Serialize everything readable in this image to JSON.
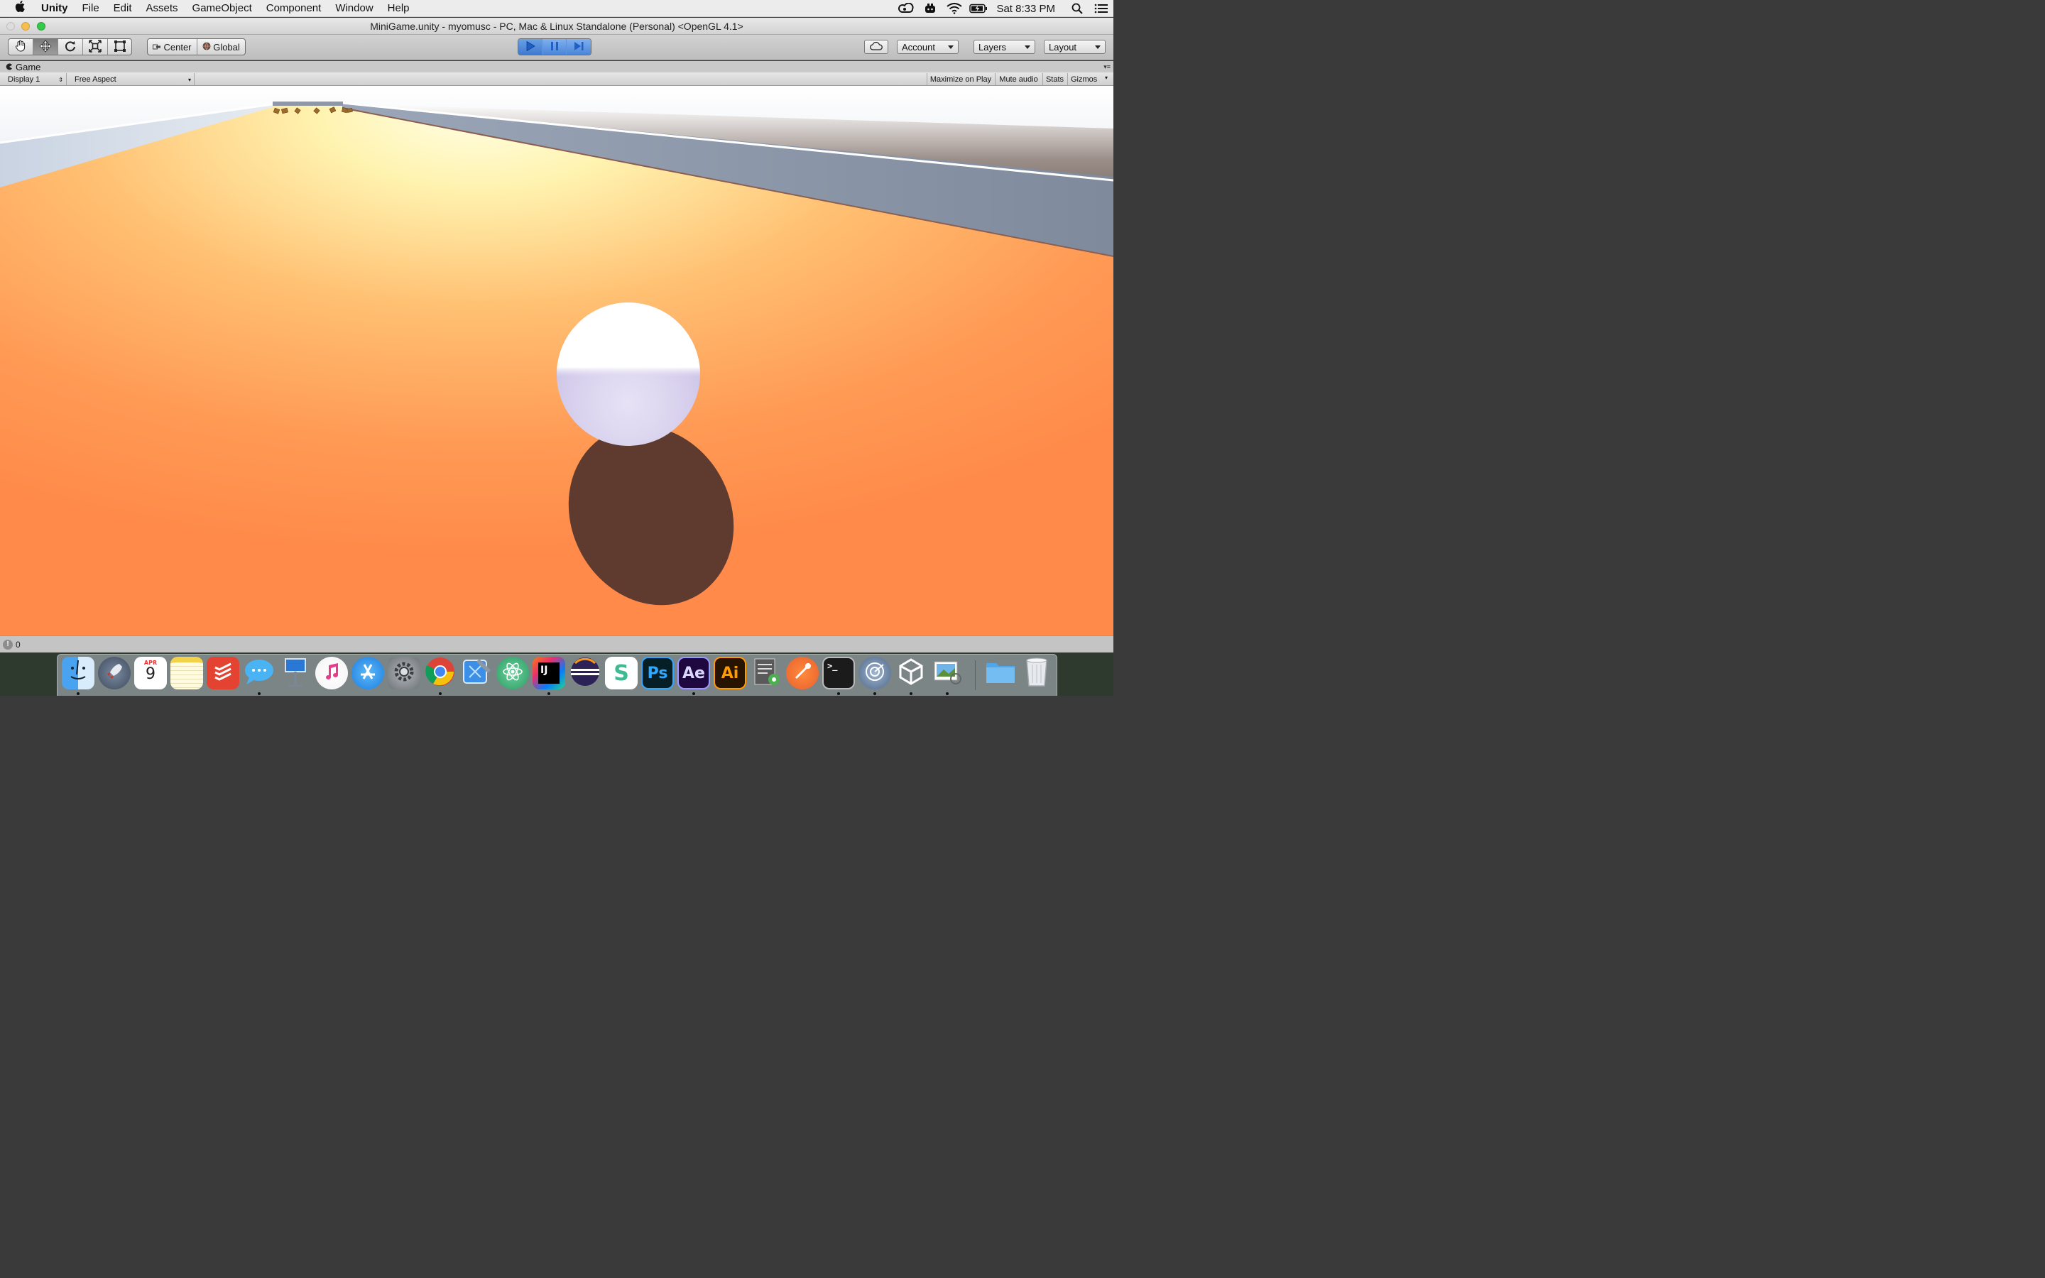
{
  "menubar": {
    "app_name": "Unity",
    "items": [
      "File",
      "Edit",
      "Assets",
      "GameObject",
      "Component",
      "Window",
      "Help"
    ],
    "clock": "Sat 8:33 PM",
    "status_icons": [
      "creative-cloud-icon",
      "game-controller-icon",
      "wifi-icon",
      "battery-icon",
      "spotlight-search-icon",
      "notification-center-icon"
    ]
  },
  "window": {
    "title": "MiniGame.unity - myomusc - PC, Mac & Linux Standalone (Personal) <OpenGL 4.1>"
  },
  "toolbar": {
    "pivot_label": "Center",
    "space_label": "Global",
    "account_label": "Account",
    "layers_label": "Layers",
    "layout_label": "Layout",
    "play_state": "playing",
    "colors": {
      "play_active": "#3f7ad0"
    }
  },
  "game_panel": {
    "tab_label": "Game",
    "display_select": "Display 1",
    "aspect_select": "Free Aspect",
    "maximize_label": "Maximize on Play",
    "mute_label": "Mute audio",
    "stats_label": "Stats",
    "gizmos_label": "Gizmos"
  },
  "scene": {
    "floor_color": "#ff8a4a",
    "highlight_color": "#fff7c8",
    "wall_color": "#8b95a6",
    "sky_color": "#ffffff",
    "ball_color": "#ece9f7",
    "shadow_color": "#5f3a2e",
    "pickup_color": "#9a6b2a"
  },
  "status": {
    "console_count": "0"
  },
  "dock": {
    "apps": [
      "Finder",
      "Launchpad",
      "Calendar",
      "Notes",
      "Todoist",
      "Messages",
      "Keynote",
      "iTunes",
      "App Store",
      "System Preferences",
      "Google Chrome",
      "Xcode",
      "Atom",
      "IntelliJ IDEA",
      "Eclipse",
      "Slack",
      "Photoshop",
      "After Effects",
      "Illustrator",
      "Script Editor",
      "Postman",
      "Terminal",
      "Dashlane",
      "Unity",
      "Preview",
      "Downloads",
      "Trash"
    ],
    "calendar_month": "APR",
    "calendar_day": "9",
    "ps_label": "Ps",
    "ae_label": "Ae",
    "ai_label": "Ai",
    "ij_label": "IJ"
  }
}
